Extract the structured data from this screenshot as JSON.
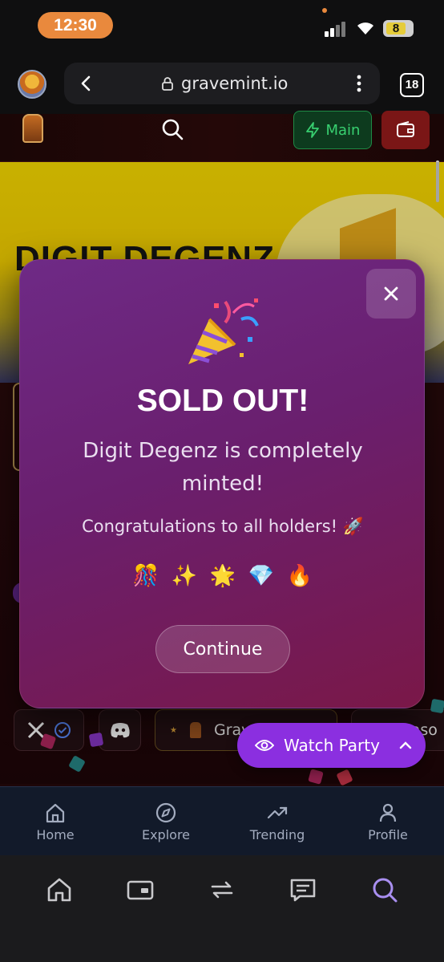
{
  "status_bar": {
    "time": "12:30",
    "battery": "8"
  },
  "browser": {
    "url": "gravemint.io",
    "tab_count": "18"
  },
  "site_header": {
    "main_label": "Main"
  },
  "banner": {
    "title": "DIGIT DEGENZ"
  },
  "page": {
    "social": {
      "gravemint_label": "Grav",
      "season_label": "Seaso"
    },
    "watch_party_label": "Watch Party"
  },
  "modal": {
    "title": "SOLD OUT!",
    "subtitle": "Digit Degenz is completely minted!",
    "congrats": "Congratulations to all holders! 🚀",
    "emojis": [
      "🎊",
      "✨",
      "🌟",
      "💎",
      "🔥"
    ],
    "continue_label": "Continue"
  },
  "site_nav": [
    {
      "label": "Home",
      "icon": "home-icon"
    },
    {
      "label": "Explore",
      "icon": "compass-icon"
    },
    {
      "label": "Trending",
      "icon": "trending-icon"
    },
    {
      "label": "Profile",
      "icon": "user-icon"
    }
  ],
  "browser_toolbar": [
    "home-icon",
    "card-icon",
    "swap-icon",
    "chat-icon",
    "search-icon"
  ],
  "colors": {
    "accent_purple": "#8b2fe0",
    "main_green": "#38d070",
    "wallet_red": "#7a1616",
    "modal_top": "#6e2a86",
    "modal_bottom": "#7a1848"
  }
}
